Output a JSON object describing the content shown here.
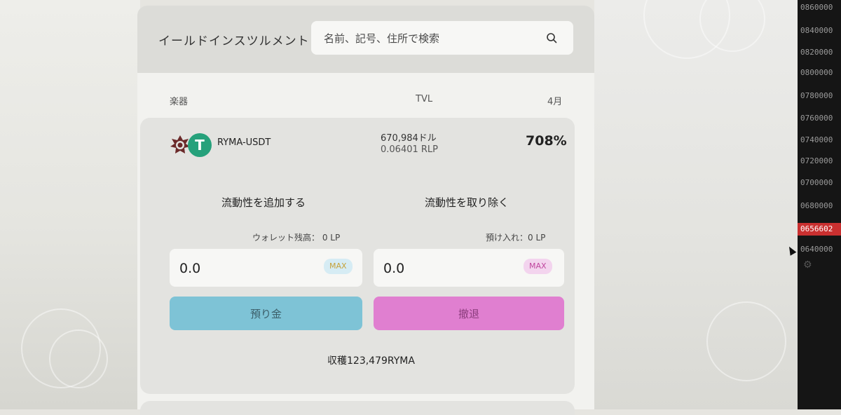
{
  "header": {
    "title": "イールドインスツルメント",
    "search_placeholder": "名前、記号、住所で検索"
  },
  "table_header": {
    "instrument": "楽器",
    "tvl": "TVL",
    "apr": "4月"
  },
  "pool": {
    "pair": "RYMA-USDT",
    "tvl_usd": "670,984ドル",
    "tvl_lp": "0.06401 RLP",
    "apr": "708%",
    "usdt_icon_glyph": "T",
    "add_liquidity": {
      "title": "流動性を追加する",
      "balance_label": "ウォレット残高： 0 LP",
      "amount": "0.0",
      "max_label": "MAX",
      "button_label": "預り金",
      "button_color": "#7ec3d6"
    },
    "remove_liquidity": {
      "title": "流動性を取り除く",
      "balance_label": "預け入れ：0 LP",
      "amount": "0.0",
      "max_label": "MAX",
      "button_label": "撤退",
      "button_color": "#e07fd0"
    },
    "harvest": "収穫123,479RYMA"
  },
  "price_scale": {
    "ticks": [
      "0860000",
      "0840000",
      "0820000",
      "0800000",
      "0780000",
      "0760000",
      "0740000",
      "0720000",
      "0700000",
      "0680000",
      "0640000"
    ],
    "current": "0656602"
  },
  "icons": {
    "search": "search-icon",
    "settings": "gear-icon",
    "cursor": "cursor-icon"
  }
}
